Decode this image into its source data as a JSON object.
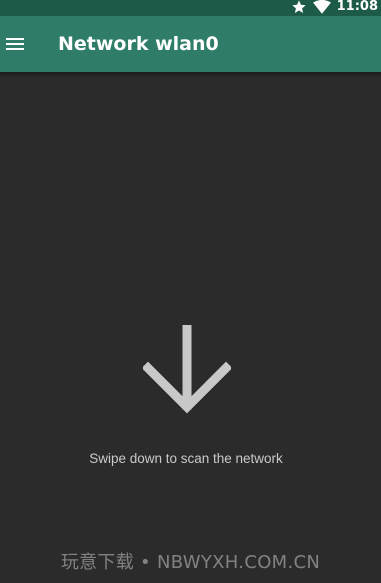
{
  "status_bar": {
    "time": "11:08",
    "icons": [
      "star-icon",
      "wifi-icon"
    ]
  },
  "app_bar": {
    "title": "Network wlan0",
    "menu_icon": "menu-icon"
  },
  "main": {
    "arrow_icon": "arrow-down-icon",
    "hint": "Swipe down to scan the network"
  },
  "watermark": "玩意下载 • NBWYXH.COM.CN",
  "colors": {
    "status_bar": "#1e5a48",
    "app_bar": "#2f7d68",
    "background": "#2b2b2b",
    "arrow": "#c8c8c8",
    "hint_text": "#c9c9c9"
  }
}
